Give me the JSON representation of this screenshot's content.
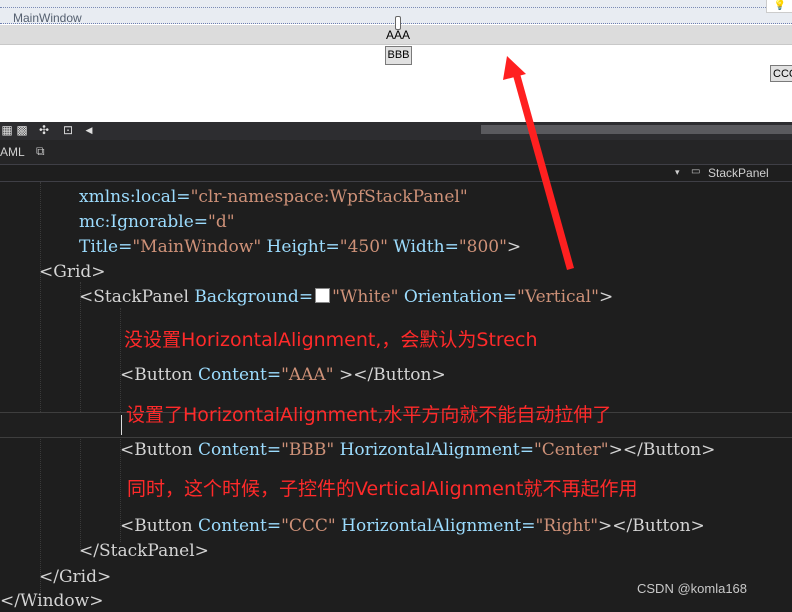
{
  "designer": {
    "window_title": "MainWindow",
    "buttons": {
      "aaa": "AAA",
      "bbb": "BBB",
      "ccc": "CCC"
    }
  },
  "toolbar": {
    "icons": [
      "grid-icon",
      "checker-icon",
      "snap-icon",
      "zoom-fit-icon",
      "scroll-left-icon"
    ]
  },
  "xaml_tab": {
    "label": "AML"
  },
  "breadcrumb": {
    "dropdown": "▾",
    "label": "StackPanel"
  },
  "code": {
    "line1": {
      "attr": "xmlns:local=",
      "val": "\"clr-namespace:WpfStackPanel\""
    },
    "line2": {
      "attr": "mc:Ignorable=",
      "val": "\"d\""
    },
    "line3": {
      "a1": "Title=",
      "v1": "\"MainWindow\"",
      "a2": " Height=",
      "v2": "\"450\"",
      "a3": " Width=",
      "v3": "\"800\"",
      "end": ">"
    },
    "line4": "<Grid>",
    "line5": {
      "open": "<StackPanel",
      "a1": " Background=",
      "v1": "\"White\"",
      "a2": " Orientation=",
      "v2": "\"Vertical\"",
      "end": ">"
    },
    "line6": {
      "open": "<Button",
      "a1": " Content=",
      "v1": "\"AAA\"",
      "end": " ></Button>"
    },
    "line7": {
      "open": "<Button",
      "a1": " Content=",
      "v1": "\"BBB\"",
      "a2": " HorizontalAlignment=",
      "v2": "\"Center\"",
      "end": "></Button>"
    },
    "line8": {
      "open": "<Button",
      "a1": " Content=",
      "v1": "\"CCC\"",
      "a2": " HorizontalAlignment=",
      "v2": "\"Right\"",
      "end": "></Button>"
    },
    "line9": "</StackPanel>",
    "line10": "</Grid>",
    "line11": "</Window>"
  },
  "annotations": {
    "note1": "没设置HorizontalAlignment,，会默认为Strech",
    "note2": "设置了HorizontalAlignment,水平方向就不能自动拉伸了",
    "note3": "同时，这个时候，子控件的VerticalAlignment就不再起作用"
  },
  "watermark": "CSDN @komla168",
  "colors": {
    "attribute": "#9cdcfe",
    "value": "#ce9178",
    "annotation": "#ff2a2a",
    "editor_bg": "#1e1e1e"
  }
}
